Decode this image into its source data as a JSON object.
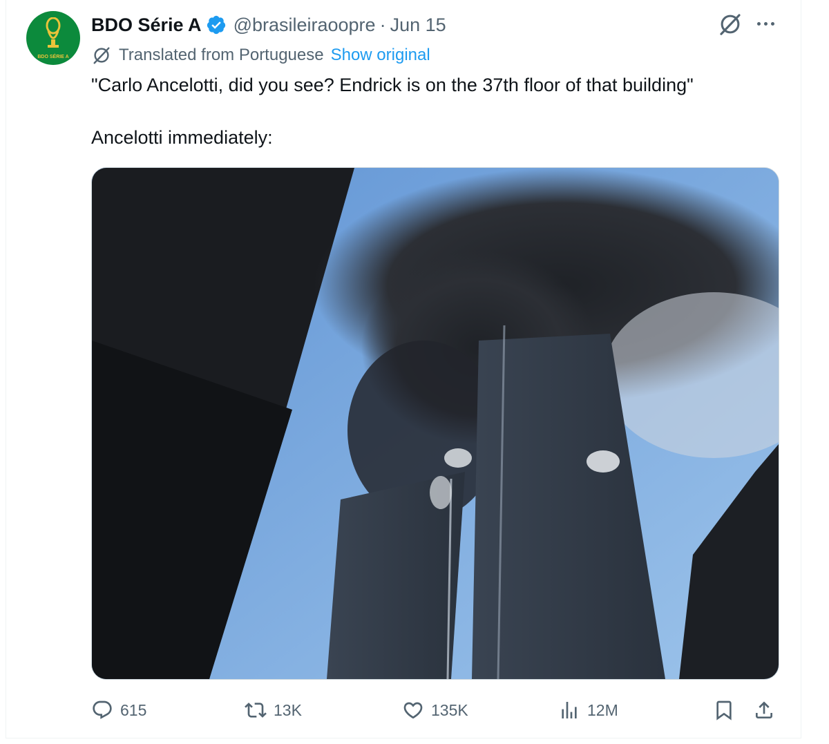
{
  "tweet": {
    "author_name": "BDO Série A",
    "handle": "@brasileiraoopre",
    "separator": "·",
    "date": "Jun 15",
    "translated_label": "Translated from Portuguese",
    "show_original": "Show original",
    "text_line1": "\"Carlo Ancelotti, did you see? Endrick is on the 37th floor of that building\"",
    "text_line2": "Ancelotti immediately:",
    "avatar_text": "BDO SÉRIE A"
  },
  "actions": {
    "replies": "615",
    "reposts": "13K",
    "likes": "135K",
    "views": "12M"
  },
  "colors": {
    "accent": "#1d9bf0",
    "secondary_text": "#536471",
    "avatar_bg": "#0c8a3c"
  },
  "icons": [
    "verified-badge-icon",
    "grok-icon",
    "more-icon",
    "translate-icon",
    "reply-icon",
    "retweet-icon",
    "like-icon",
    "views-icon",
    "bookmark-icon",
    "share-icon"
  ]
}
